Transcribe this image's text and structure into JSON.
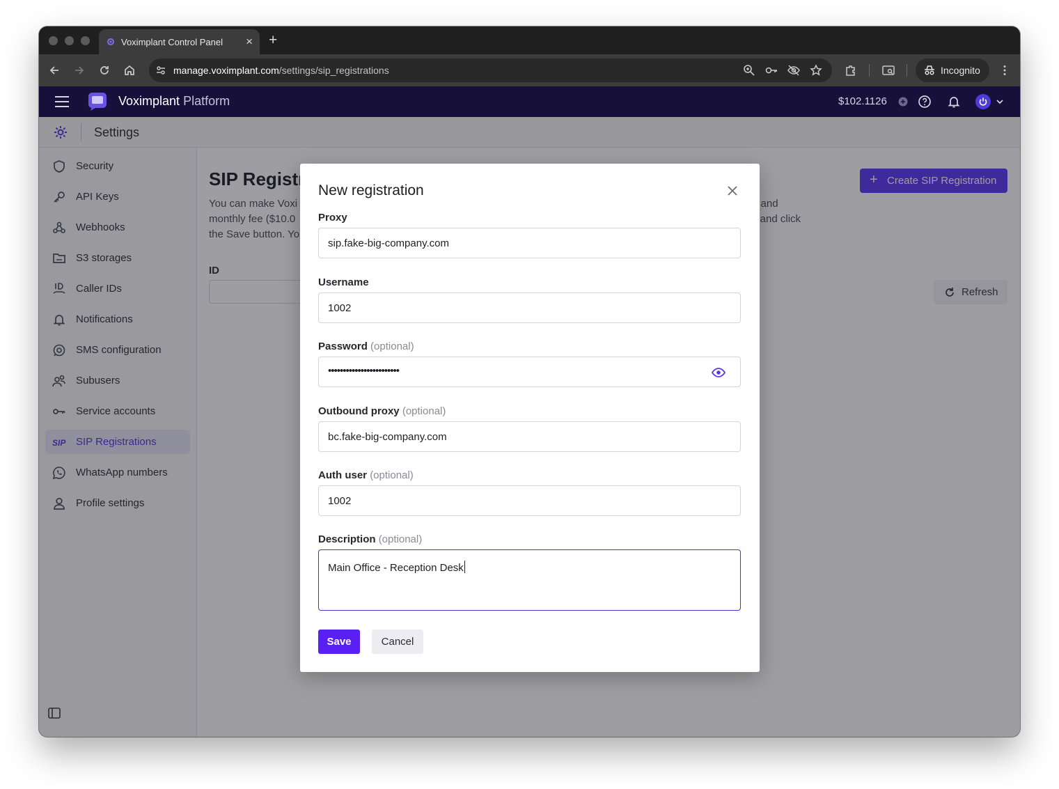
{
  "browser": {
    "tab_title": "Voximplant Control Panel",
    "url_host": "manage.voximplant.com",
    "url_path": "/settings/sip_registrations",
    "incognito_label": "Incognito"
  },
  "app": {
    "brand_bold": "Voximplant",
    "brand_light": " Platform",
    "balance": "$102.1126"
  },
  "settings": {
    "title": "Settings"
  },
  "sidebar": {
    "items": [
      {
        "label": "Security",
        "icon": "shield-icon"
      },
      {
        "label": "API Keys",
        "icon": "key-icon"
      },
      {
        "label": "Webhooks",
        "icon": "webhook-icon"
      },
      {
        "label": "S3 storages",
        "icon": "folder-icon"
      },
      {
        "label": "Caller IDs",
        "icon": "caller-id-icon"
      },
      {
        "label": "Notifications",
        "icon": "bell-icon"
      },
      {
        "label": "SMS configuration",
        "icon": "sms-icon"
      },
      {
        "label": "Subusers",
        "icon": "users-icon"
      },
      {
        "label": "Service accounts",
        "icon": "service-key-icon"
      },
      {
        "label": "SIP Registrations",
        "icon": "sip-icon",
        "active": true
      },
      {
        "label": "WhatsApp numbers",
        "icon": "whatsapp-icon"
      },
      {
        "label": "Profile settings",
        "icon": "user-icon"
      }
    ]
  },
  "main": {
    "title": "SIP Registr",
    "desc_left_1": "You can make Voxi",
    "desc_right_1": "e and",
    "desc_left_2": "monthly fee ($10.0",
    "desc_right_2": "s and click",
    "desc_left_3": "the Save button. Yo",
    "create_button": "Create SIP Registration",
    "id_label": "ID",
    "refresh_button": "Refresh"
  },
  "modal": {
    "title": "New registration",
    "proxy_label": "Proxy",
    "proxy_value": "sip.fake-big-company.com",
    "username_label": "Username",
    "username_value": "1002",
    "password_label": "Password",
    "password_optional": "(optional)",
    "password_mask": "••••••••••••••••••••••••",
    "outbound_label": "Outbound proxy",
    "outbound_optional": "(optional)",
    "outbound_value": "bc.fake-big-company.com",
    "authuser_label": "Auth user",
    "authuser_optional": "(optional)",
    "authuser_value": "1002",
    "description_label": "Description",
    "description_optional": "(optional)",
    "description_value": "Main Office - Reception Desk",
    "save_button": "Save",
    "cancel_button": "Cancel"
  },
  "colors": {
    "accent": "#5a37f2",
    "header_bg": "#16103a",
    "active_nav_bg": "#e7e5f9"
  }
}
